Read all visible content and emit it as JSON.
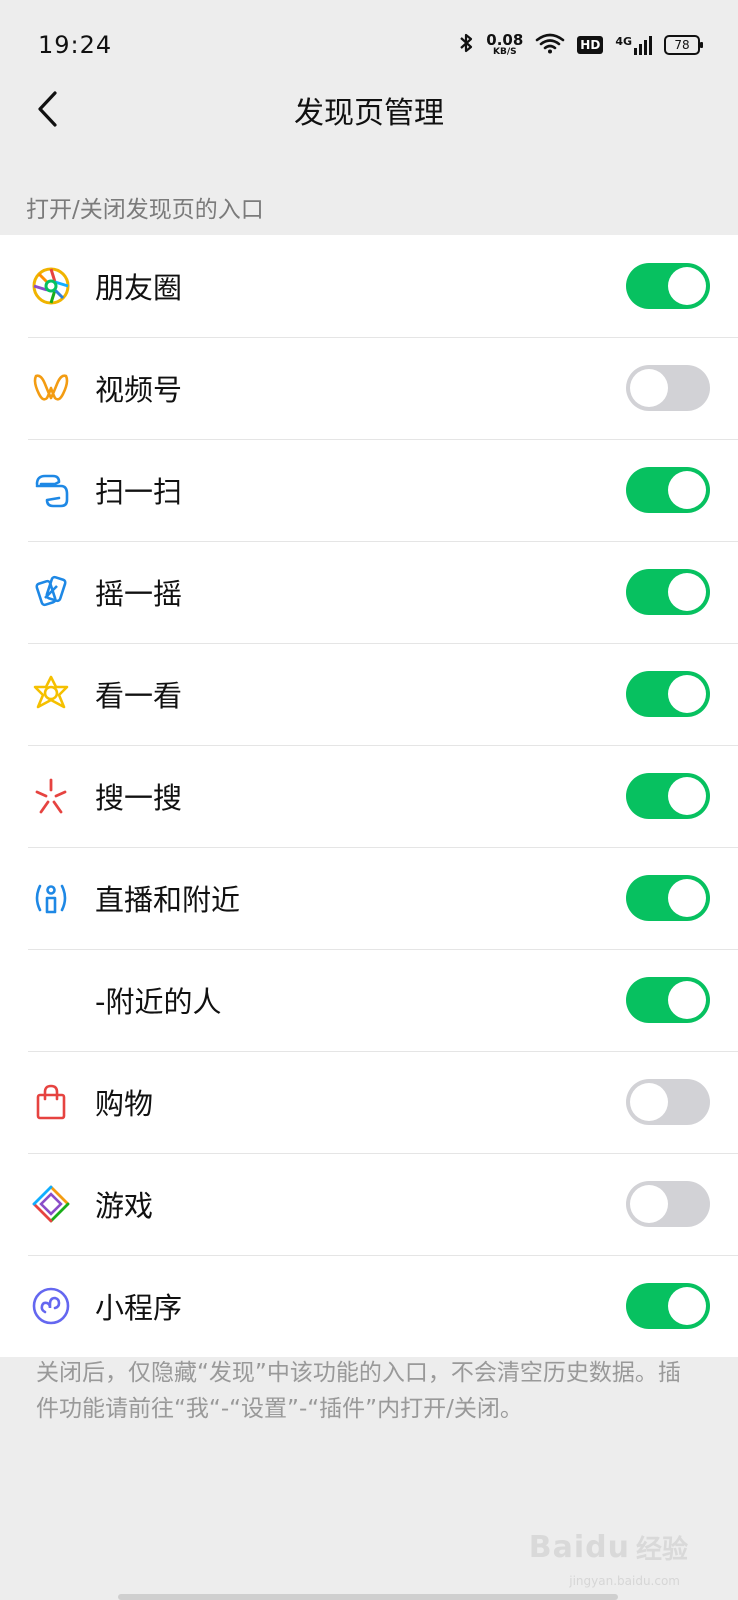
{
  "status_bar": {
    "time": "19:24",
    "net_speed_value": "0.08",
    "net_speed_unit": "KB/S",
    "hd_label": "HD",
    "network_label": "4G",
    "battery": "78"
  },
  "nav": {
    "title": "发现页管理"
  },
  "section_header": "打开/关闭发现页的入口",
  "items": [
    {
      "label": "朋友圈",
      "icon": "moments-icon",
      "on": true
    },
    {
      "label": "视频号",
      "icon": "channels-icon",
      "on": false
    },
    {
      "label": "扫一扫",
      "icon": "scan-icon",
      "on": true
    },
    {
      "label": "摇一摇",
      "icon": "shake-icon",
      "on": true
    },
    {
      "label": "看一看",
      "icon": "top-stories-icon",
      "on": true
    },
    {
      "label": "搜一搜",
      "icon": "search-icon",
      "on": true
    },
    {
      "label": "直播和附近",
      "icon": "live-nearby-icon",
      "on": true
    },
    {
      "label": "-附近的人",
      "icon": "",
      "on": true
    },
    {
      "label": "购物",
      "icon": "shopping-bag-icon",
      "on": false
    },
    {
      "label": "游戏",
      "icon": "games-icon",
      "on": false
    },
    {
      "label": "小程序",
      "icon": "mini-programs-icon",
      "on": true
    }
  ],
  "footer_note": "关闭后，仅隐藏“发现”中该功能的入口，不会清空历史数据。插件功能请前往“我“-“设置”-“插件”内打开/关闭。",
  "watermark": {
    "main": "Baidu",
    "cn": "经验",
    "sub": "jingyan.baidu.com"
  },
  "colors": {
    "toggle_on": "#07c160",
    "toggle_off": "#d2d2d6",
    "background": "#ededed"
  }
}
